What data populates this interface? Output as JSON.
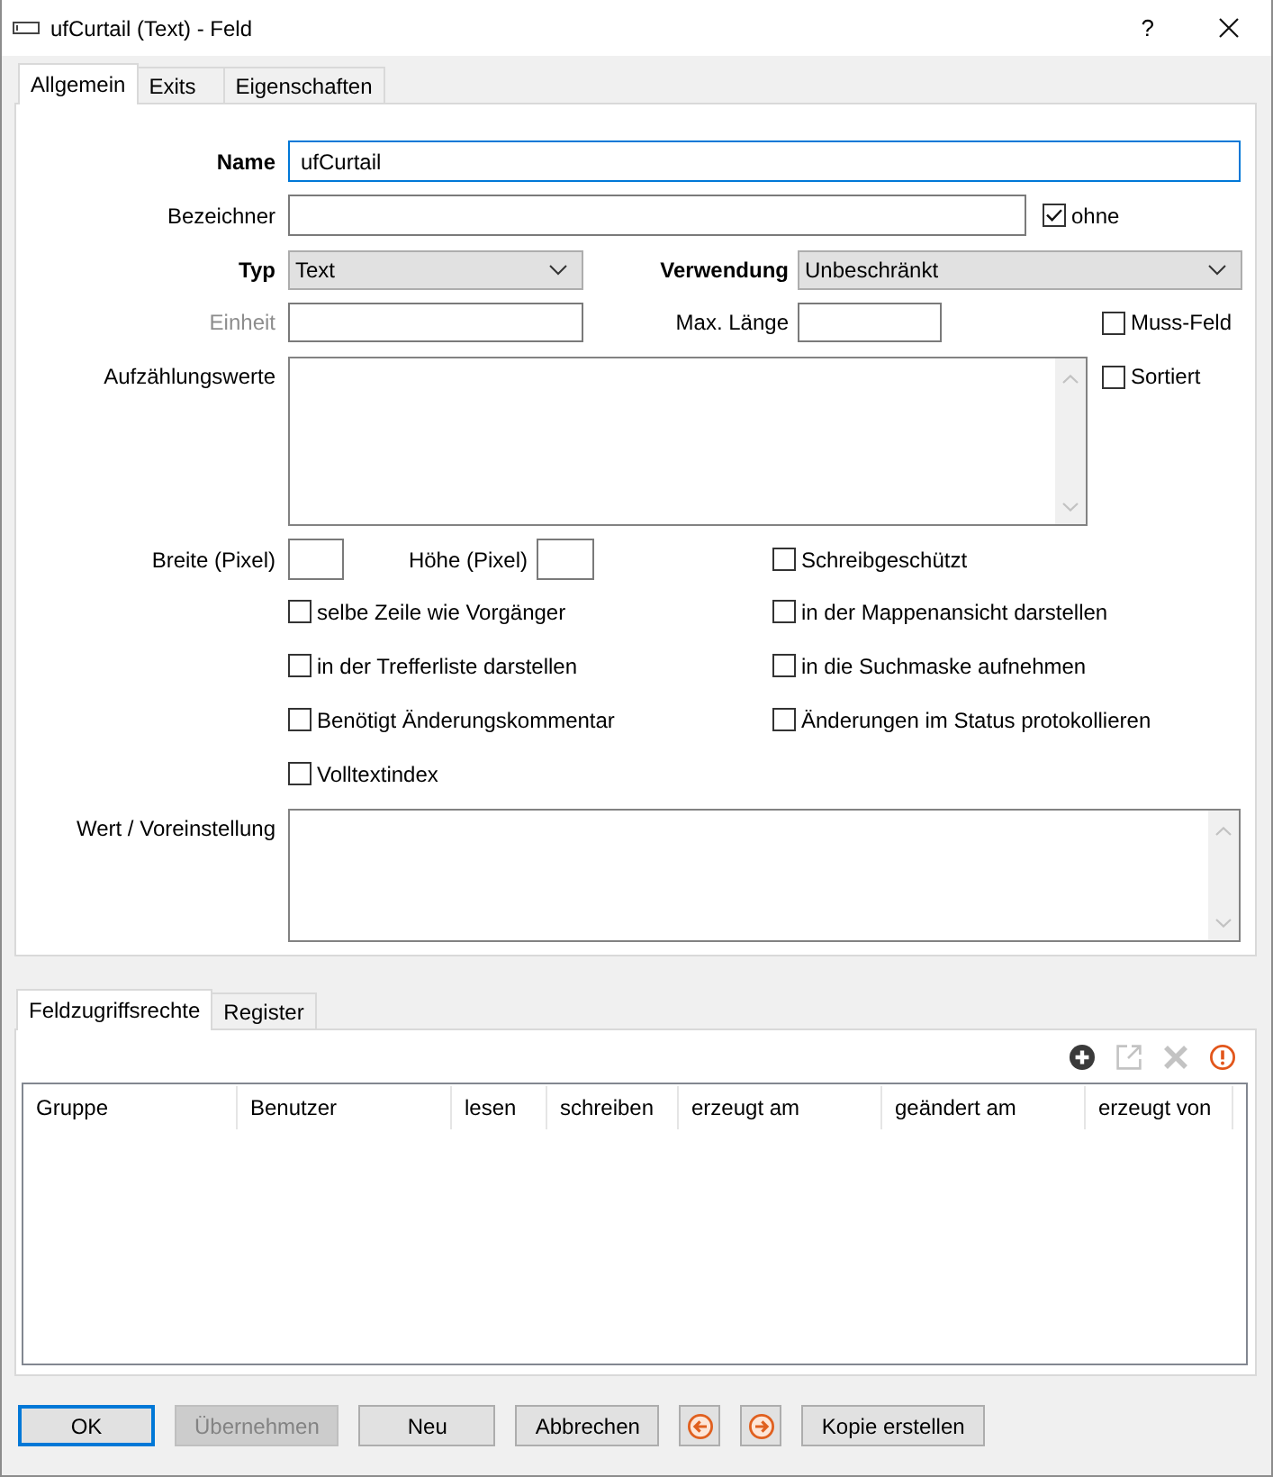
{
  "window": {
    "title": "ufCurtail (Text) - Feld",
    "help": "?"
  },
  "tabs": [
    {
      "label": "Allgemein",
      "selected": true
    },
    {
      "label": "Exits",
      "selected": false
    },
    {
      "label": "Eigenschaften",
      "selected": false
    }
  ],
  "general": {
    "name": {
      "label": "Name",
      "required": true,
      "value": "ufCurtail",
      "focused": true
    },
    "identifier": {
      "label": "Bezeichner",
      "required": false
    },
    "identifier_none": {
      "label": "ohne",
      "checked": true
    },
    "type": {
      "label": "Typ",
      "required": true,
      "value": "Text"
    },
    "usage": {
      "label": "Verwendung",
      "required": true,
      "value": "Unbeschränkt"
    },
    "unit": {
      "label": "Einheit",
      "required": false,
      "disabled": true
    },
    "max_length": {
      "label": "Max. Länge",
      "required": false
    },
    "mandatory": {
      "label": "Muss-Feld",
      "checked": false
    },
    "enum_values": {
      "label": "Aufzählungswerte",
      "required": false
    },
    "sorted": {
      "label": "Sortiert",
      "checked": false
    },
    "width": {
      "label": "Breite (Pixel)",
      "required": false
    },
    "height": {
      "label": "Höhe (Pixel)",
      "required": false
    },
    "read_only": {
      "label": "Schreibgeschützt",
      "checked": false
    },
    "options": [
      {
        "label": "selbe Zeile wie Vorgänger",
        "checked": false
      },
      {
        "label": "in der Mappenansicht darstellen",
        "checked": false
      },
      {
        "label": "in der Trefferliste darstellen",
        "checked": false
      },
      {
        "label": "in die Suchmaske aufnehmen",
        "checked": false
      },
      {
        "label": "Benötigt Änderungskommentar",
        "checked": false
      },
      {
        "label": "Änderungen im Status protokollieren",
        "checked": false
      },
      {
        "label": "Volltextindex",
        "checked": false
      }
    ],
    "default_value": {
      "label": "Wert / Voreinstellung",
      "required": false
    }
  },
  "lower_tabs": [
    {
      "label": "Feldzugriffsrechte",
      "selected": true
    },
    {
      "label": "Register",
      "selected": false
    }
  ],
  "toolbar": [
    {
      "kind": "add",
      "disabled": false
    },
    {
      "kind": "edit",
      "disabled": true
    },
    {
      "kind": "delete",
      "disabled": true
    },
    {
      "kind": "warning",
      "disabled": false
    }
  ],
  "table": {
    "columns": [
      "Gruppe",
      "Benutzer",
      "lesen",
      "schreiben",
      "erzeugt am",
      "geändert am",
      "erzeugt von"
    ]
  },
  "buttons": [
    {
      "kind": "text",
      "label": "OK",
      "default": true,
      "disabled": false
    },
    {
      "kind": "text",
      "label": "Übernehmen",
      "default": false,
      "disabled": true
    },
    {
      "kind": "text",
      "label": "Neu",
      "default": false,
      "disabled": false
    },
    {
      "kind": "text",
      "label": "Abbrechen",
      "default": false,
      "disabled": false
    },
    {
      "kind": "back",
      "default": false,
      "disabled": false
    },
    {
      "kind": "forward",
      "default": false,
      "disabled": false
    },
    {
      "kind": "text",
      "label": "Kopie erstellen",
      "default": false,
      "disabled": false
    }
  ]
}
